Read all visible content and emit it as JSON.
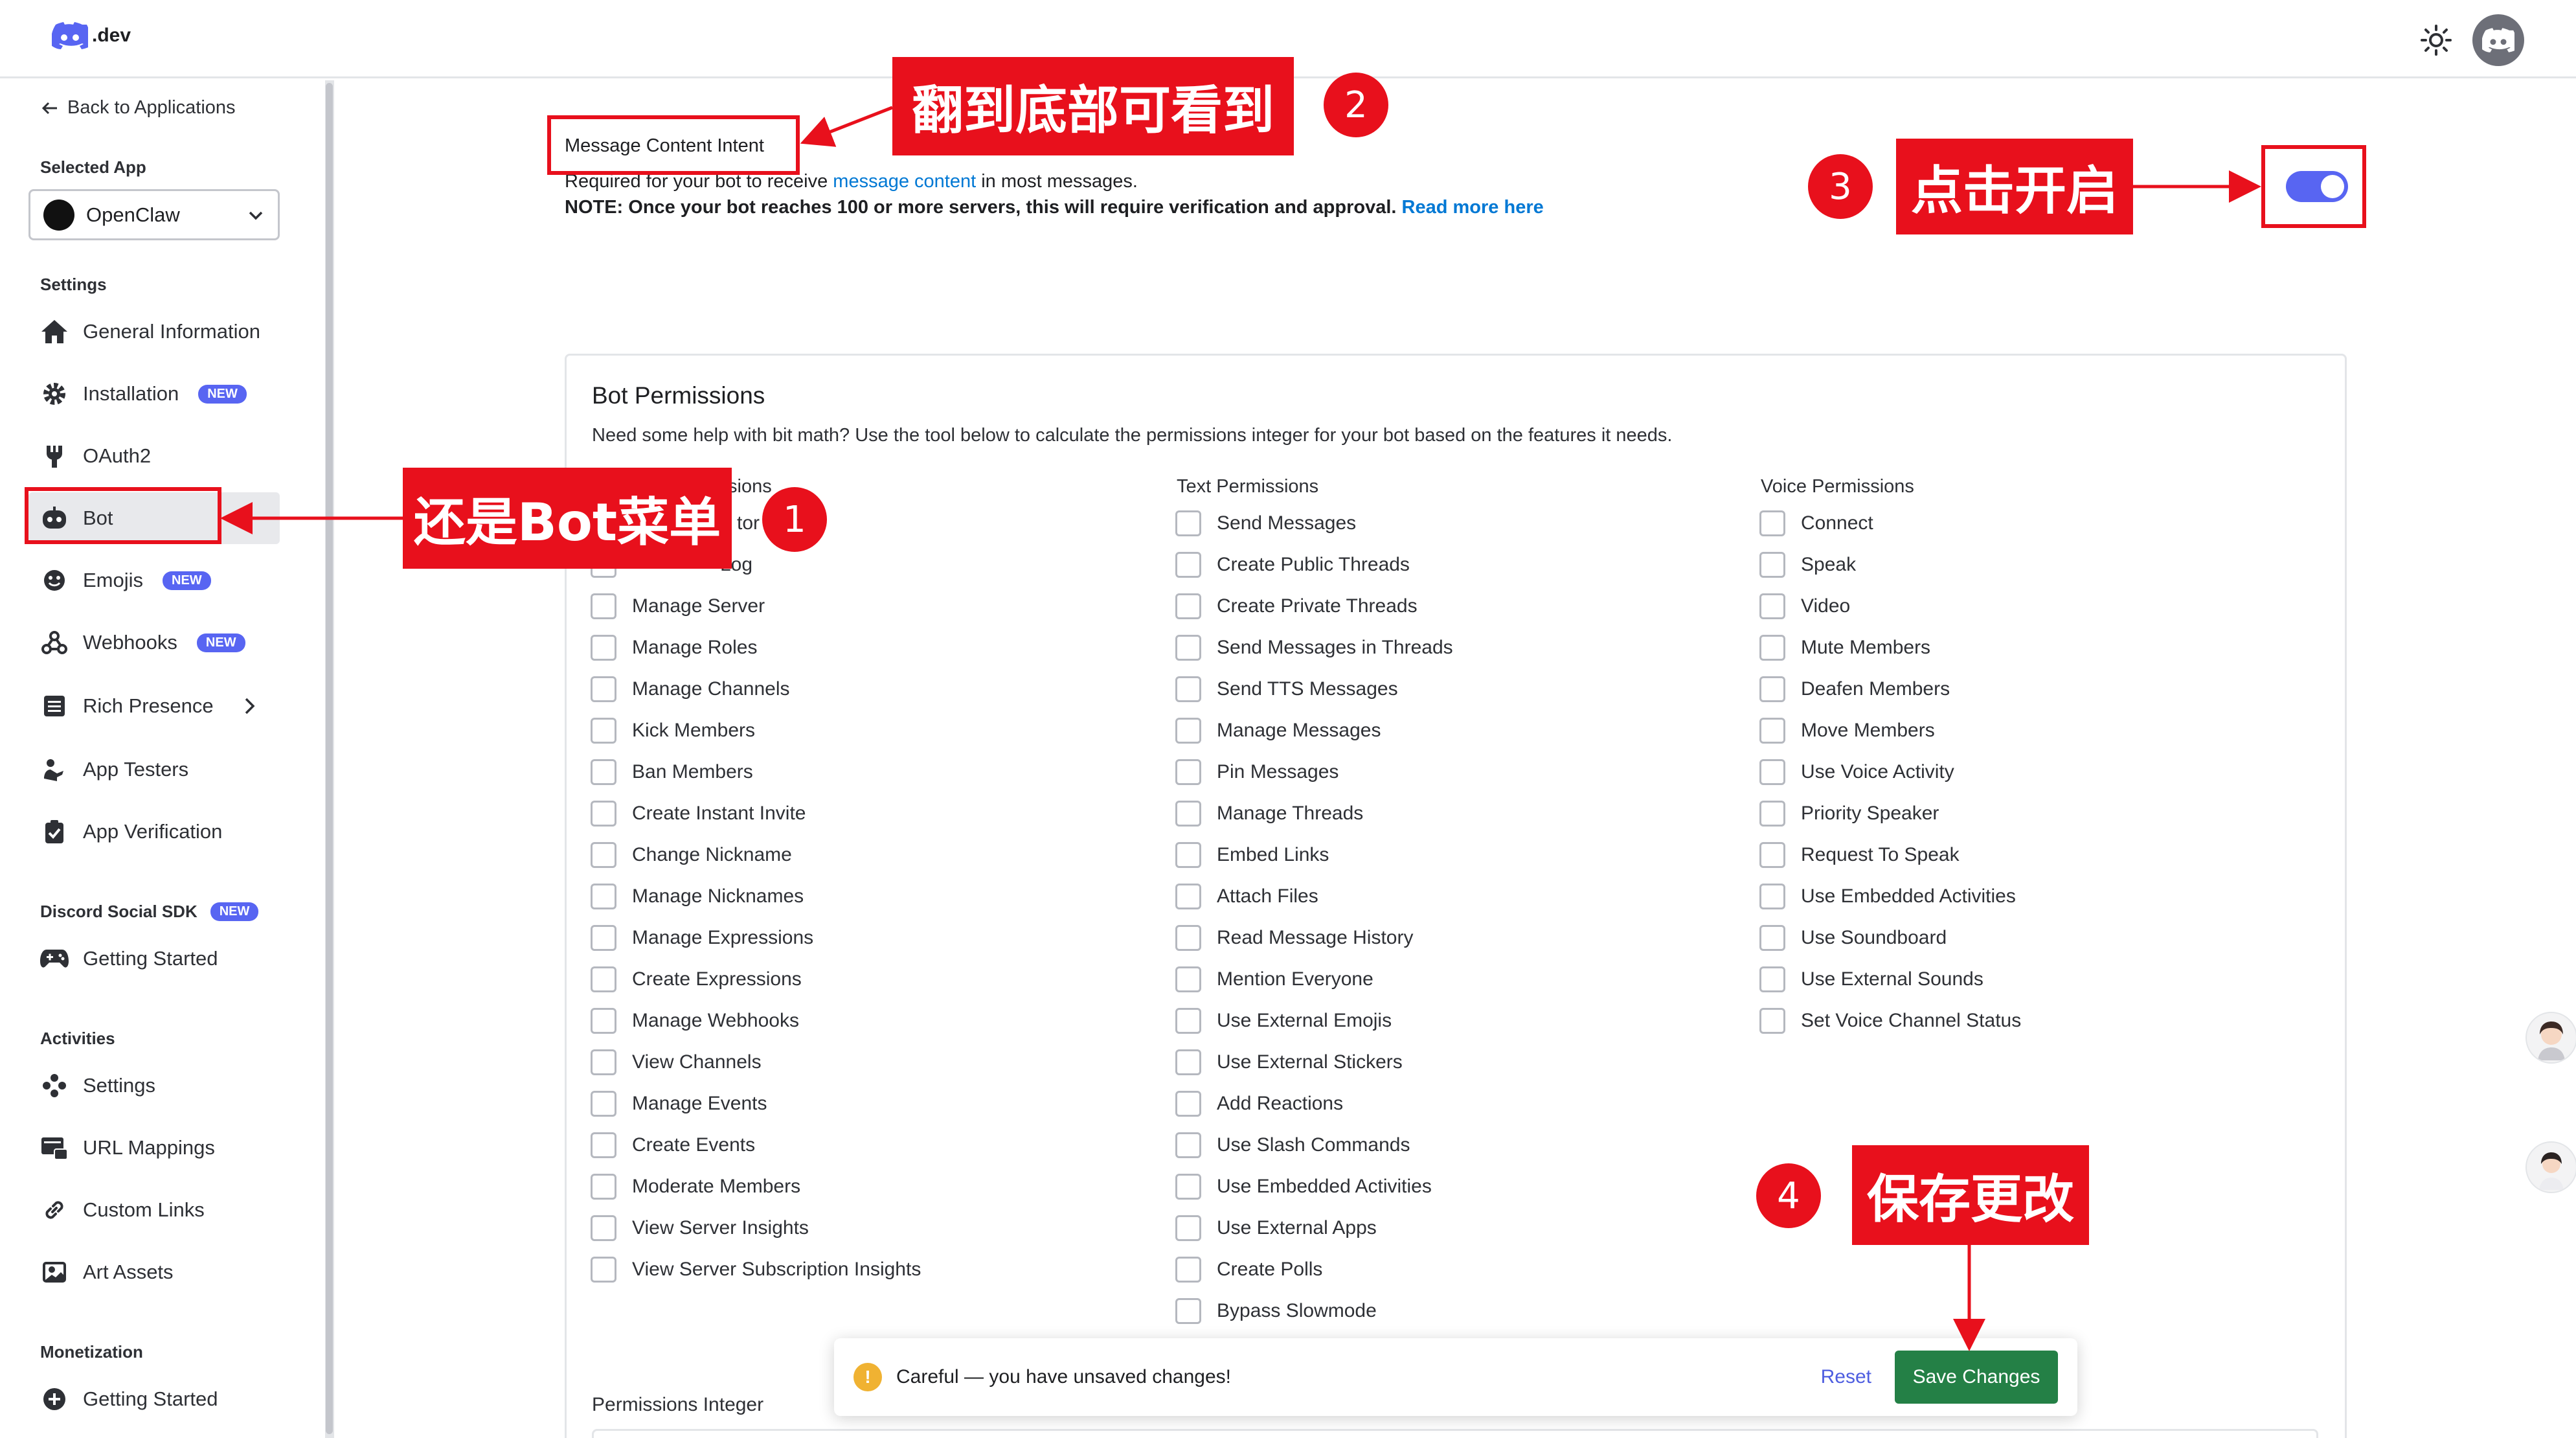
{
  "topbar": {
    "logo_text": ".dev",
    "theme_icon": "sun-icon",
    "account_icon": "discord-icon"
  },
  "sidebar": {
    "back_label": "Back to Applications",
    "selected_app_heading": "Selected App",
    "selected_app": "OpenClaw",
    "settings_heading": "Settings",
    "settings_items": [
      {
        "label": "General Information",
        "icon": "home-icon"
      },
      {
        "label": "Installation",
        "icon": "gear-icon",
        "badge": "NEW"
      },
      {
        "label": "OAuth2",
        "icon": "wrench-icon"
      },
      {
        "label": "Bot",
        "icon": "bot-icon"
      },
      {
        "label": "Emojis",
        "icon": "smile-icon",
        "badge": "NEW"
      },
      {
        "label": "Webhooks",
        "icon": "webhook-icon",
        "badge": "NEW"
      },
      {
        "label": "Rich Presence",
        "icon": "list-icon"
      },
      {
        "label": "App Testers",
        "icon": "testers-icon"
      },
      {
        "label": "App Verification",
        "icon": "verified-icon"
      }
    ],
    "sdk_heading": "Discord Social SDK",
    "sdk_badge": "NEW",
    "sdk_items": [
      {
        "label": "Getting Started",
        "icon": "gamepad-icon"
      }
    ],
    "activities_heading": "Activities",
    "activities_items": [
      {
        "label": "Settings",
        "icon": "activity-settings-icon"
      },
      {
        "label": "URL Mappings",
        "icon": "url-icon"
      },
      {
        "label": "Custom Links",
        "icon": "link-icon"
      },
      {
        "label": "Art Assets",
        "icon": "image-icon"
      }
    ],
    "monetization_heading": "Monetization",
    "monetization_items": [
      {
        "label": "Getting Started",
        "icon": "plus-circle-icon"
      }
    ]
  },
  "intent": {
    "title": "Message Content Intent",
    "line1_pre": "Required for your bot to receive ",
    "line1_link": "message content",
    "line1_post": " in most messages.",
    "line2_note": "NOTE: Once your bot reaches 100 or more servers, this will require verification and approval.",
    "line2_link": "Read more here",
    "toggle_on": true
  },
  "permissions": {
    "title": "Bot Permissions",
    "description": "Need some help with bit math? Use the tool below to calculate the permissions integer for your bot based on the features it needs.",
    "general": {
      "heading_visible": "sions",
      "items": [
        "tor",
        "Log",
        "Manage Server",
        "Manage Roles",
        "Manage Channels",
        "Kick Members",
        "Ban Members",
        "Create Instant Invite",
        "Change Nickname",
        "Manage Nicknames",
        "Manage Expressions",
        "Create Expressions",
        "Manage Webhooks",
        "View Channels",
        "Manage Events",
        "Create Events",
        "Moderate Members",
        "View Server Insights",
        "View Server Subscription Insights"
      ]
    },
    "text": {
      "heading": "Text Permissions",
      "items": [
        "Send Messages",
        "Create Public Threads",
        "Create Private Threads",
        "Send Messages in Threads",
        "Send TTS Messages",
        "Manage Messages",
        "Pin Messages",
        "Manage Threads",
        "Embed Links",
        "Attach Files",
        "Read Message History",
        "Mention Everyone",
        "Use External Emojis",
        "Use External Stickers",
        "Add Reactions",
        "Use Slash Commands",
        "Use Embedded Activities",
        "Use External Apps",
        "Create Polls",
        "Bypass Slowmode"
      ]
    },
    "voice": {
      "heading": "Voice Permissions",
      "items": [
        "Connect",
        "Speak",
        "Video",
        "Mute Members",
        "Deafen Members",
        "Move Members",
        "Use Voice Activity",
        "Priority Speaker",
        "Request To Speak",
        "Use Embedded Activities",
        "Use Soundboard",
        "Use External Sounds",
        "Set Voice Channel Status"
      ]
    },
    "integer_label": "Permissions Integer"
  },
  "unsaved_bar": {
    "message": "Careful — you have unsaved changes!",
    "warn_glyph": "!",
    "reset_label": "Reset",
    "save_label": "Save Changes"
  },
  "annotations": {
    "a1": {
      "label": "还是Bot菜单",
      "num": "1"
    },
    "a2": {
      "label": "翻到底部可看到",
      "num": "2"
    },
    "a3": {
      "label": "点击开启",
      "num": "3"
    },
    "a4": {
      "label": "保存更改",
      "num": "4"
    },
    "color": "#e8101c"
  },
  "colors": {
    "accent": "#5865f2",
    "save_green": "#248046",
    "link_blue": "#0078d4"
  }
}
